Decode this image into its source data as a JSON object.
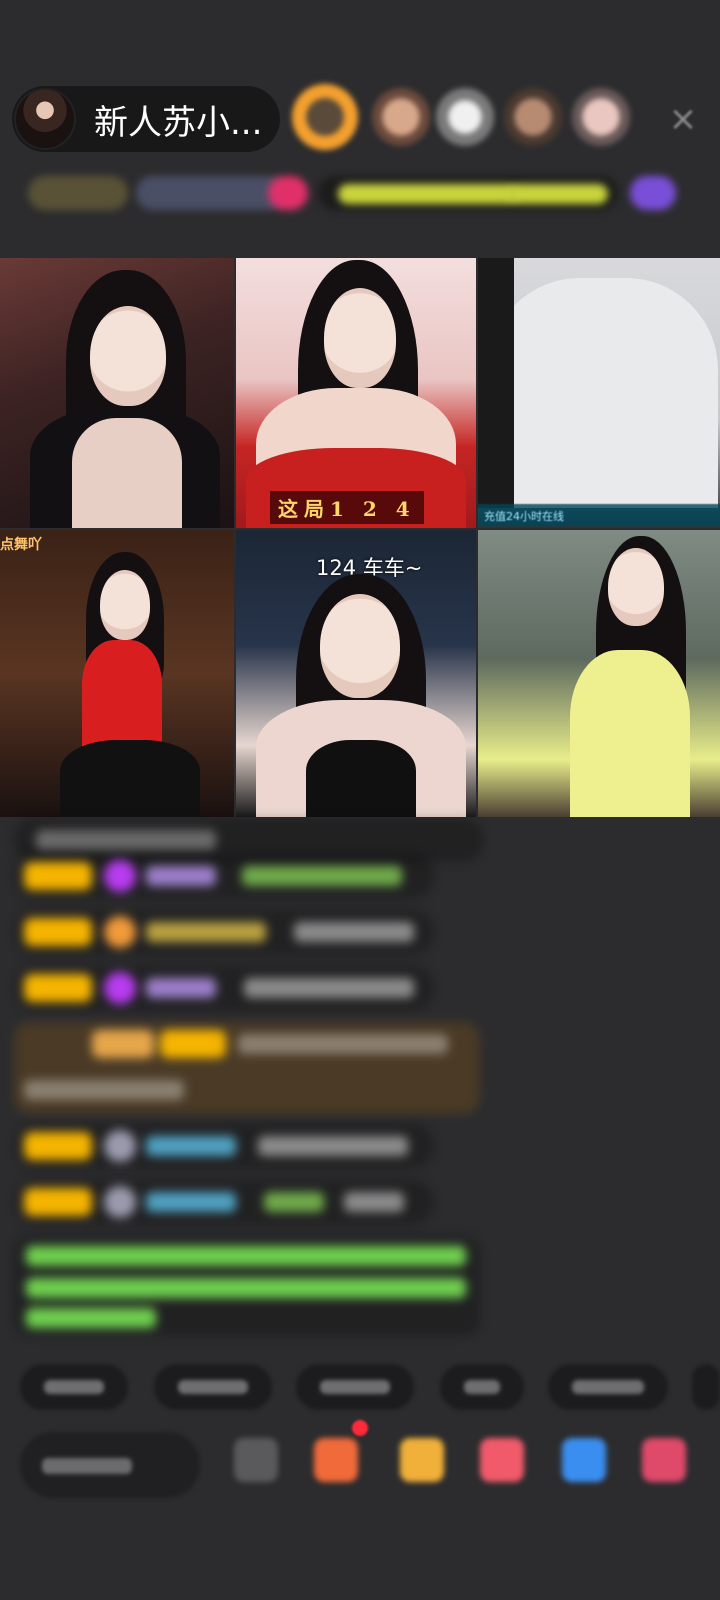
{
  "header": {
    "host_name": "新人苏小...",
    "close_label": "×"
  },
  "video_grid": {
    "tiles": [
      {
        "caption": ""
      },
      {
        "caption": "这局1 2 4"
      },
      {
        "caption": "充值24小时在线"
      },
      {
        "caption": "点舞吖"
      },
      {
        "caption": "124 车车~"
      },
      {
        "caption": ""
      }
    ]
  },
  "colors": {
    "background": "#2c2c2e",
    "level_badge": "#f5b400",
    "chat_green": "#6fcf4f",
    "notify_dot": "#ff2a3a"
  }
}
